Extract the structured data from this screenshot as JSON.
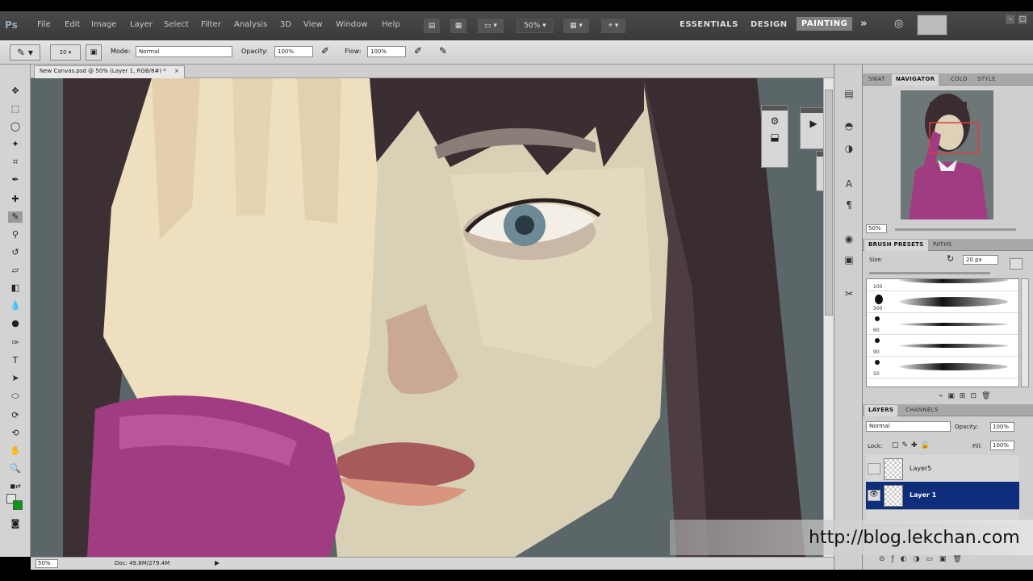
{
  "app": {
    "logo": "Ps"
  },
  "menu": [
    "File",
    "Edit",
    "Image",
    "Layer",
    "Select",
    "Filter",
    "Analysis",
    "3D",
    "View",
    "Window",
    "Help"
  ],
  "appbar": {
    "zoom": "50%"
  },
  "workspaces": {
    "essentials": "ESSENTIALS",
    "design": "DESIGN",
    "painting": "PAINTING"
  },
  "options": {
    "brush_size": "20",
    "mode_label": "Mode:",
    "mode_value": "Normal",
    "opacity_label": "Opacity:",
    "opacity_value": "100%",
    "flow_label": "Flow:",
    "flow_value": "100%"
  },
  "document": {
    "tab_title": "New Canvas.psd @ 50% (Layer 1, RGB/8#) *",
    "tab_close": "×",
    "status_zoom": "50%",
    "status_doc": "Doc: 49.8M/279.4M"
  },
  "navigator_panel": {
    "tabs": [
      "SWAT",
      "NAVIGATOR",
      "COLO",
      "STYLE"
    ],
    "zoom": "50%"
  },
  "brush_presets_panel": {
    "tabs": [
      "BRUSH PRESETS",
      "PATHS"
    ],
    "size_label": "Size:",
    "size_value": "20 px",
    "brushes": [
      {
        "size": "100"
      },
      {
        "size": "500"
      },
      {
        "size": "60"
      },
      {
        "size": "90"
      },
      {
        "size": "50"
      }
    ]
  },
  "layers_panel": {
    "tabs": [
      "LAYERS",
      "CHANNELS"
    ],
    "blend_mode": "Normal",
    "opacity_label": "Opacity:",
    "opacity_value": "100%",
    "lock_label": "Lock:",
    "fill_label": "Fill:",
    "fill_value": "100%",
    "layers": [
      {
        "name": "Layer5",
        "visible": false,
        "selected": false
      },
      {
        "name": "Layer 1",
        "visible": true,
        "selected": true
      }
    ]
  },
  "watermark": "http://blog.lekchan.com",
  "colors": {
    "selected_layer": "#0e2d7a",
    "active_workspace": "#7f7f7f",
    "canvas_bg": "#5b6669"
  }
}
